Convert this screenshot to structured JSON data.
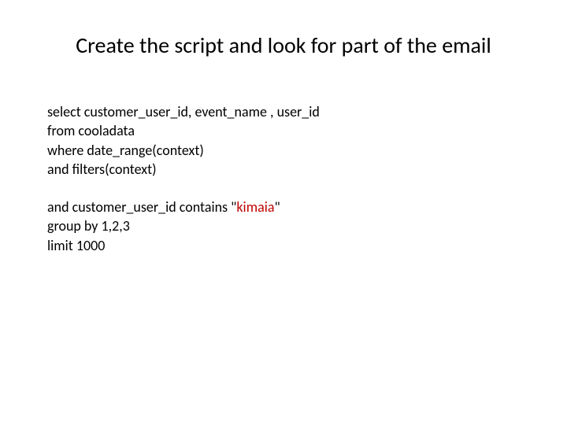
{
  "title": "Create the script and look for part of the email",
  "lines": {
    "l1": "select customer_user_id, event_name , user_id",
    "l2": "from cooladata",
    "l3": "where date_range(context)",
    "l4": "and filters(context)",
    "l6_prefix": "and customer_user_id contains \"",
    "l6_highlight": "kimaia",
    "l6_suffix": "\"",
    "l7": "group by 1,2,3",
    "l8": "limit 1000"
  }
}
